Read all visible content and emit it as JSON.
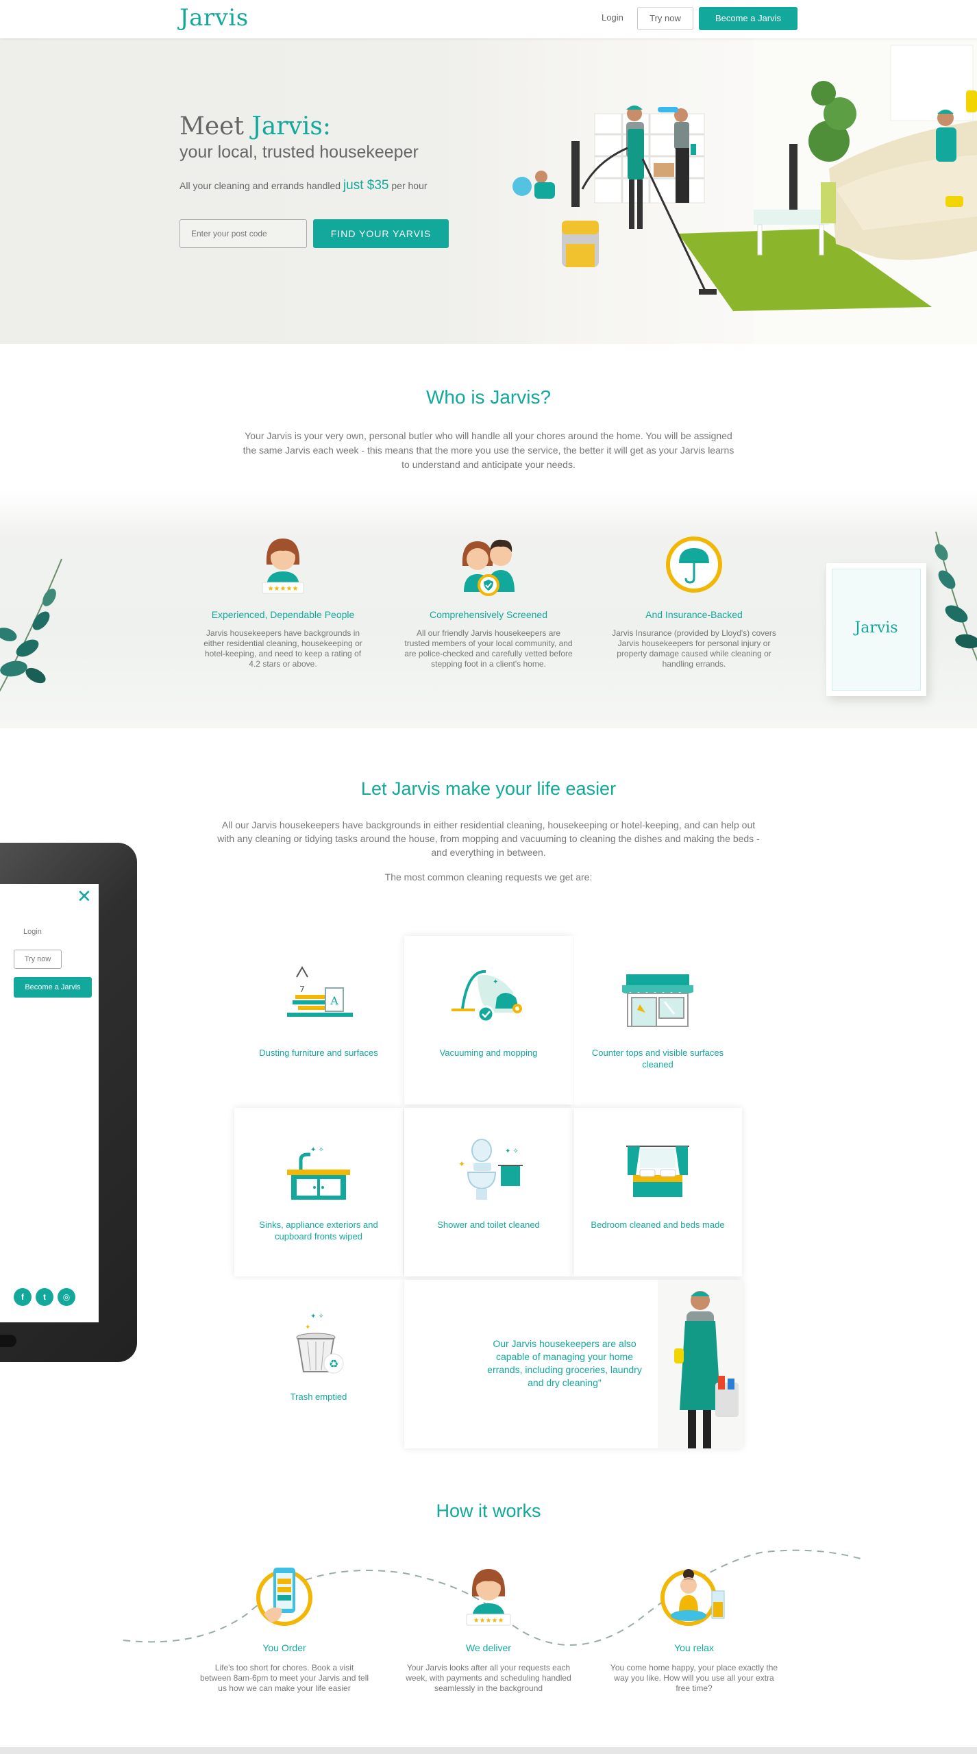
{
  "nav": {
    "logo": "Jarvis",
    "login": "Login",
    "try_now": "Try now",
    "become": "Become a Jarvis"
  },
  "hero": {
    "meet": "Meet ",
    "name": "Jarvis:",
    "subtitle": "your local, trusted housekeeper",
    "price_prefix": "All your cleaning and errands handled ",
    "price_amount": "just $35",
    "price_suffix": " per hour",
    "postcode_placeholder": "Enter your post code",
    "cta": "FIND YOUR YARVIS"
  },
  "who": {
    "title": "Who is Jarvis?",
    "text": "Your Jarvis is your very own, personal butler who will handle all your chores around the home. You will be assigned the same Jarvis each week - this means that the more you use the service, the better it will get as your Jarvis learns to understand and anticipate your needs."
  },
  "features": [
    {
      "title": "Experienced, Dependable People",
      "text": "Jarvis housekeepers have backgrounds in either residential cleaning, housekeeping or hotel-keeping, and need to keep a rating of 4.2 stars or above."
    },
    {
      "title": "Comprehensively Screened",
      "text": "All our friendly Jarvis housekeepers are trusted members of your local community, and are police-checked and carefully vetted before stepping foot in a client's home."
    },
    {
      "title": "And Insurance-Backed",
      "text": "Jarvis Insurance (provided by Lloyd's) covers Jarvis housekeepers for  personal injury or property damage caused while cleaning or handling errands."
    }
  ],
  "frame_logo": "Jarvis",
  "easier": {
    "title": "Let Jarvis make your life easier",
    "text": "All our Jarvis housekeepers have backgrounds in either residential cleaning, housekeeping or hotel-keeping, and can help out with any cleaning or tidying tasks around the house, from mopping and vacuuming to cleaning the dishes and making the beds - and everything in between.",
    "common": "The most common cleaning requests we get are:"
  },
  "phone": {
    "login": "Login",
    "try_now": "Try now",
    "become": "Become a Jarvis"
  },
  "services": [
    {
      "label": "Dusting furniture and surfaces",
      "icon": "dusting-icon"
    },
    {
      "label": "Vacuuming and mopping",
      "icon": "vacuum-icon"
    },
    {
      "label": "Counter tops and visible surfaces cleaned",
      "icon": "storefront-icon"
    },
    {
      "label": "Sinks, appliance exteriors and cupboard fronts wiped",
      "icon": "sink-icon"
    },
    {
      "label": "Shower and toilet cleaned",
      "icon": "toilet-icon"
    },
    {
      "label": "Bedroom cleaned and beds made",
      "icon": "bed-icon"
    },
    {
      "label": "Trash emptied",
      "icon": "trash-icon"
    }
  ],
  "errands": "Our Jarvis housekeepers are also capable of managing your home errands, including groceries, laundry and dry cleaning\"",
  "rating_badge": "★★★★★",
  "how": {
    "title": "How it works",
    "steps": [
      {
        "title": "You Order",
        "text": "Life's too short for chores. Book a visit between 8am-6pm to meet your Jarvis and tell us how we can make your life easier"
      },
      {
        "title": "We deliver",
        "text": "Your Jarvis looks after all your requests each week, with payments and scheduling handled seamlessly in the background"
      },
      {
        "title": "You relax",
        "text": "You come home happy, your place exactly the way you like. How will you use all your extra free time?"
      }
    ]
  },
  "colors": {
    "accent": "#12a89c",
    "gold": "#f2b705"
  }
}
